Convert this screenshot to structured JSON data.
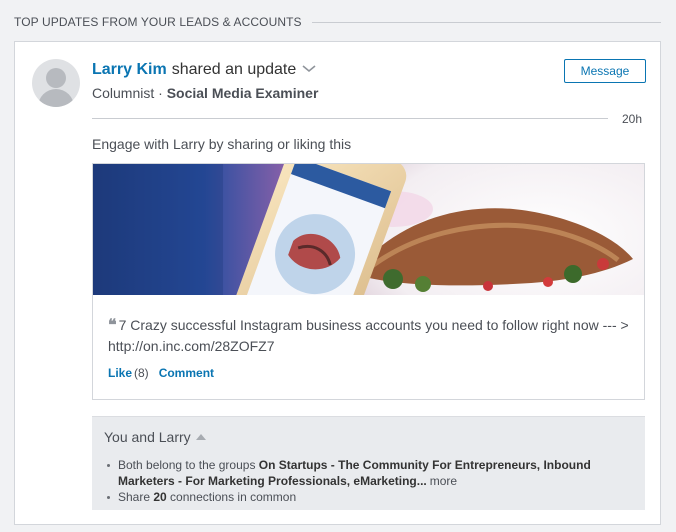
{
  "section": {
    "header": "TOP UPDATES FROM YOUR LEADS & ACCOUNTS"
  },
  "update": {
    "actor_name": "Larry Kim",
    "action": "shared an update",
    "headline_prefix": "Columnist · ",
    "company": "Social Media Examiner",
    "message_label": "Message",
    "timestamp": "20h",
    "engage_prompt": "Engage with Larry by sharing or liking this",
    "share": {
      "quote_mark": "❝",
      "text": "7 Crazy successful Instagram business accounts you need to follow right now --- > http://on.inc.com/28ZOFZ7"
    },
    "social": {
      "like_label": "Like",
      "like_count": "(8)",
      "comment_label": "Comment"
    }
  },
  "relations": {
    "title": "You and Larry",
    "groups_prefix": "Both belong to the groups ",
    "groups_names": "On Startups - The Community For Entrepreneurs, Inbound Marketers - For Marketing Professionals, eMarketing...",
    "more_label": "more",
    "connections_prefix": "Share ",
    "connections_count": "20",
    "connections_suffix": " connections in common"
  },
  "icons": {
    "avatar": "person-silhouette-icon",
    "dropdown": "chevron-down-icon",
    "collapse": "caret-up-icon",
    "quote": "quote-icon"
  },
  "colors": {
    "link_blue": "#0a75b2",
    "page_bg": "#f1f2f4",
    "card_border": "#d3d6db",
    "relations_bg": "#e9ebee"
  }
}
